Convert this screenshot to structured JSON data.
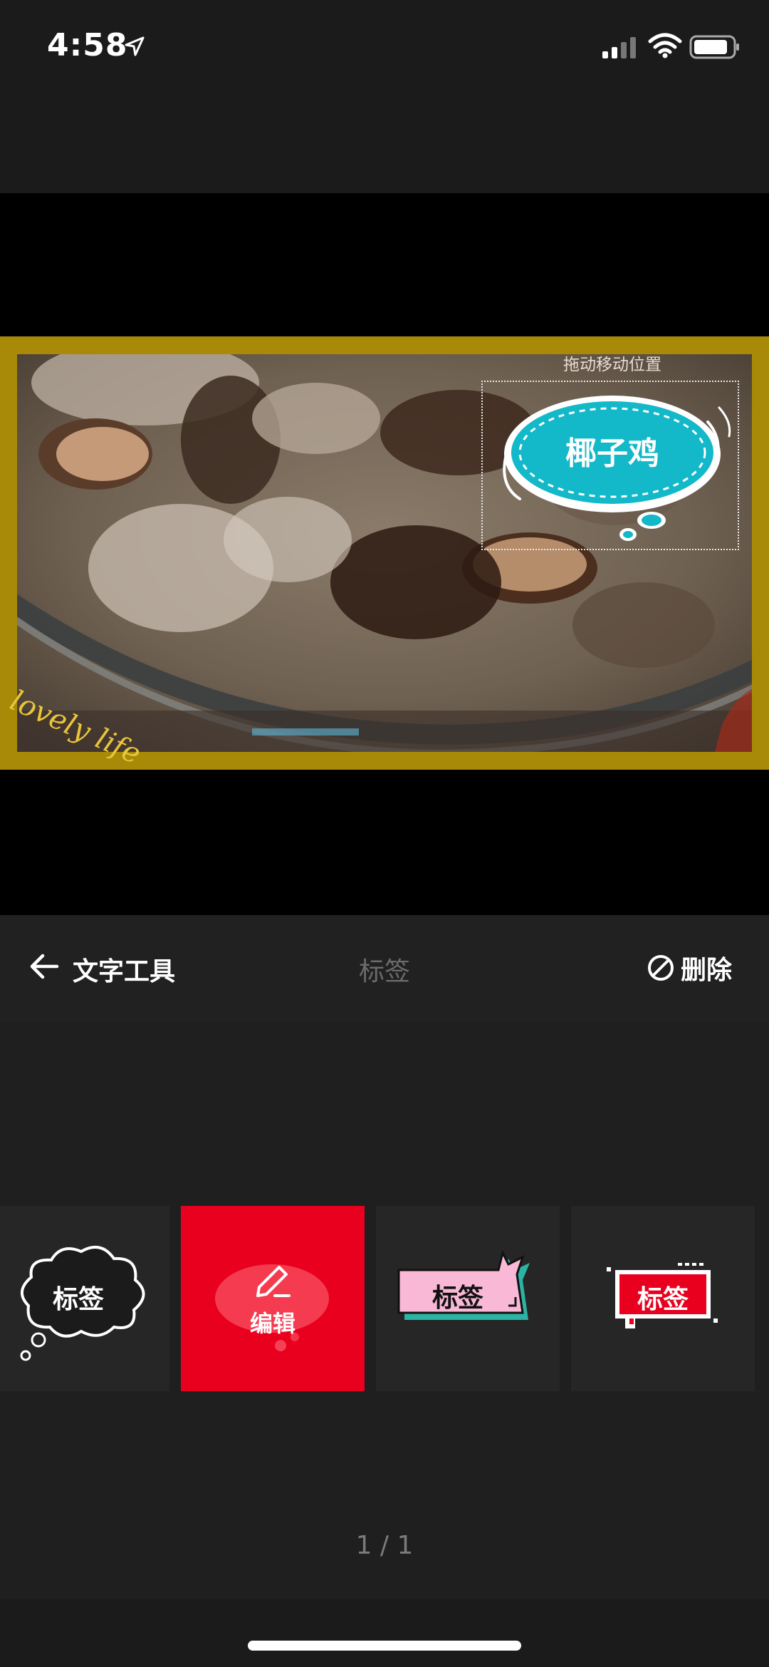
{
  "status_bar": {
    "time": "4:58"
  },
  "preview": {
    "drag_hint": "拖动移动位置",
    "sticker_text": "椰子鸡",
    "watermark_text": "lovely life"
  },
  "toolbar": {
    "back_label": "文字工具",
    "tab_label": "标签",
    "delete_label": "删除"
  },
  "stickers": [
    {
      "text": "标签",
      "style": "cloud"
    },
    {
      "text": "编辑",
      "style": "edit",
      "selected": true
    },
    {
      "text": "标签",
      "style": "pink-comic"
    },
    {
      "text": "标签",
      "style": "red-pixel"
    }
  ],
  "pagination": {
    "text": "1 / 1"
  },
  "colors": {
    "accent": "#e8001e",
    "frame": "#a98a08",
    "bubble": "#13b8c9"
  }
}
